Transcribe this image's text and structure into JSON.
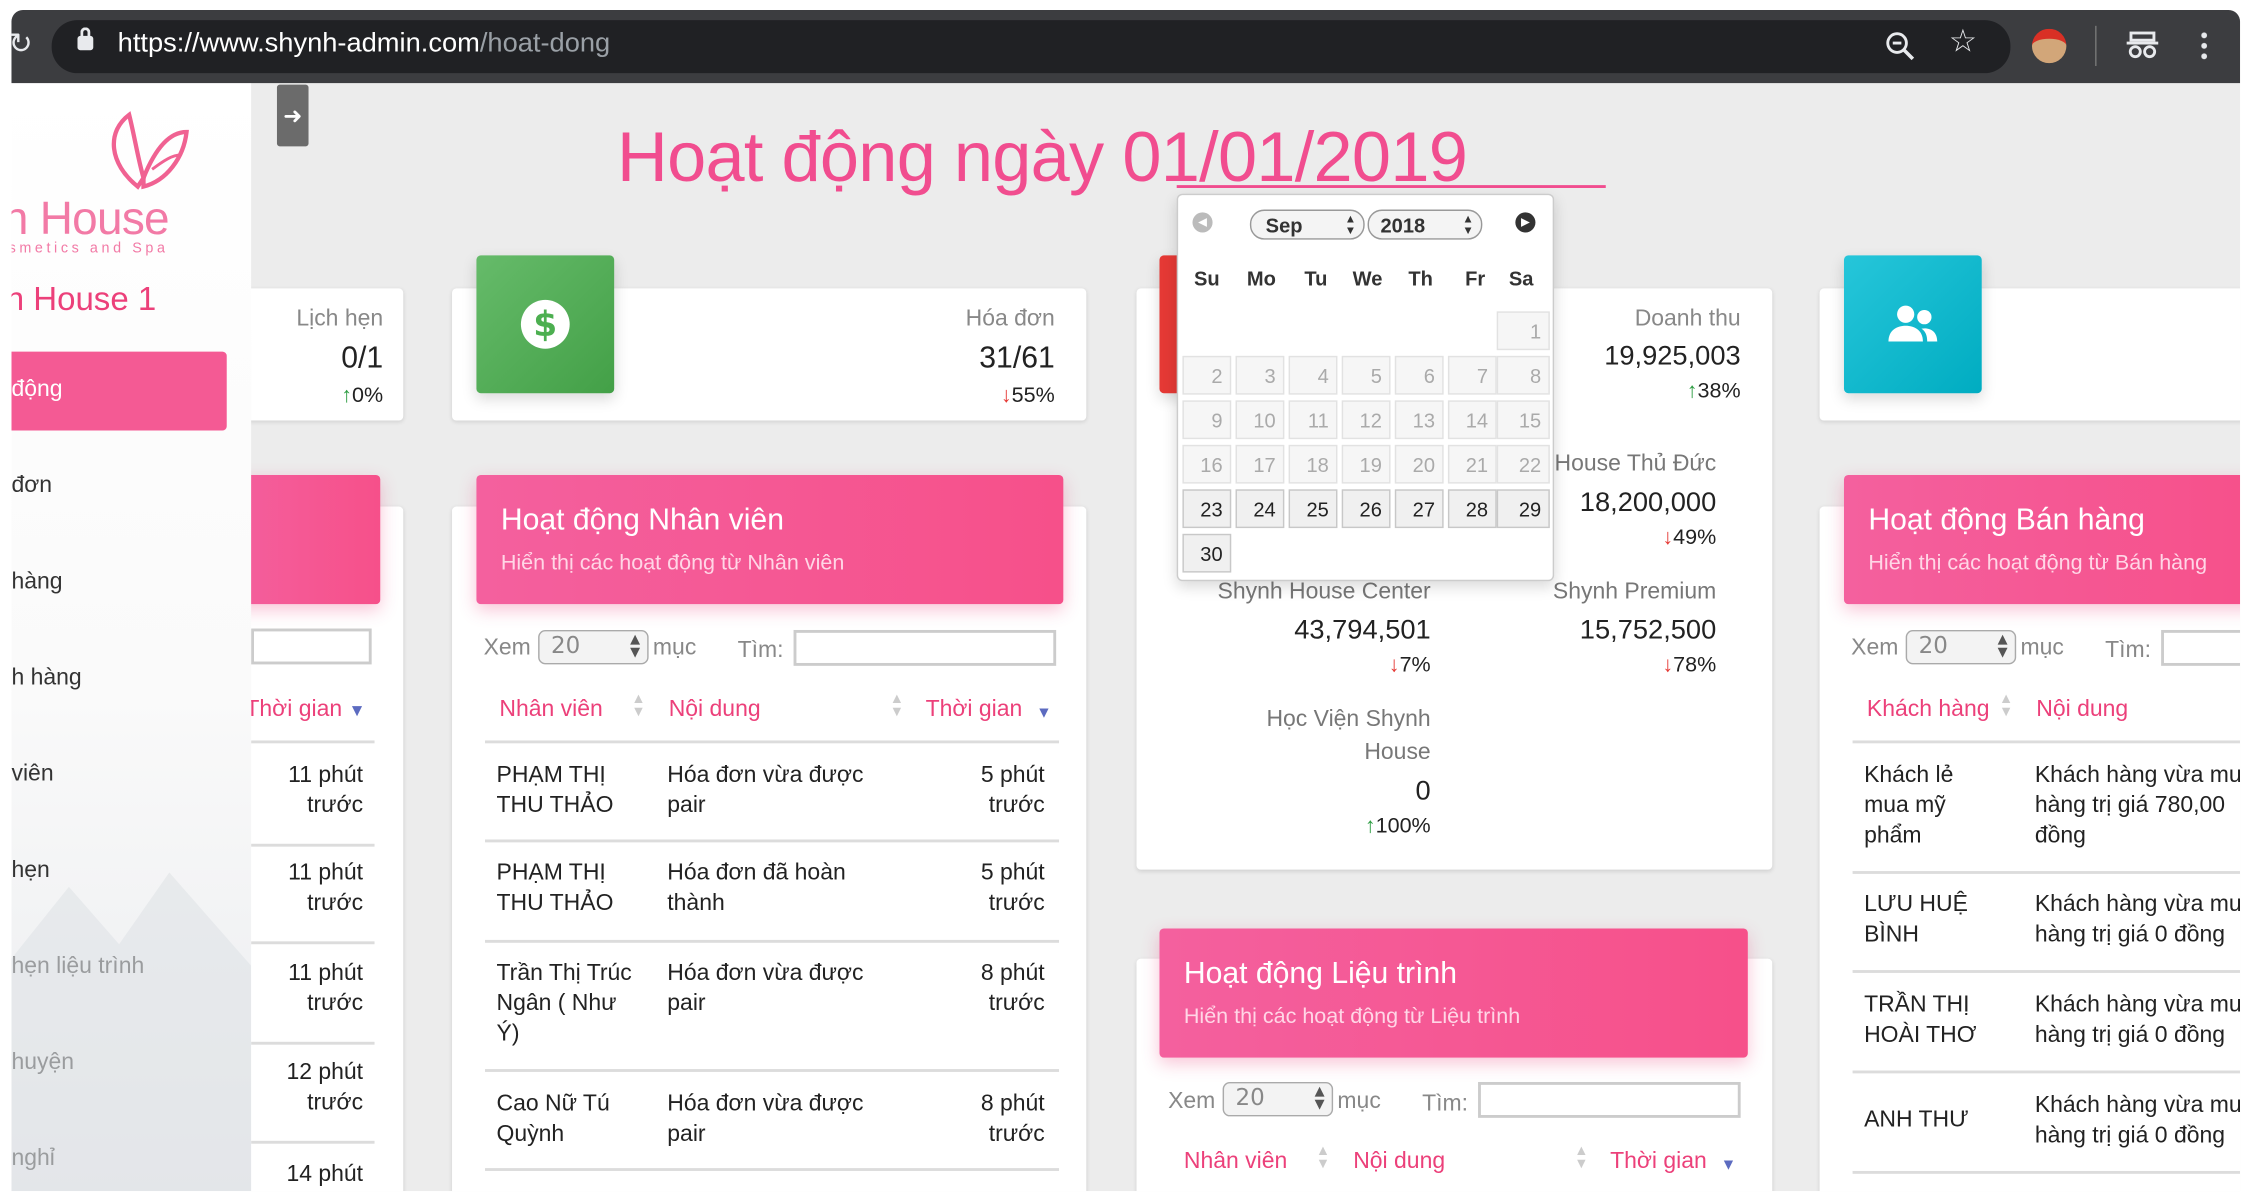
{
  "browser": {
    "url_main": "https://www.shynh-admin.com",
    "url_path": "/hoat-dong",
    "icons": [
      "reload-icon",
      "lock-icon",
      "zoom-icon",
      "star-icon",
      "extension-avatar-icon",
      "incognito-icon",
      "menu-kebab-icon"
    ]
  },
  "sidebar": {
    "logo_line1": "n House",
    "logo_line2": "smetics and Spa",
    "branch": "n House 1",
    "items": [
      {
        "label": "động",
        "active": true
      },
      {
        "label": "đơn"
      },
      {
        "label": "hàng"
      },
      {
        "label": "h hàng"
      },
      {
        "label": "viên"
      },
      {
        "label": "hẹn"
      },
      {
        "label": "hẹn liệu trình"
      },
      {
        "label": "huyện"
      },
      {
        "label": "nghỉ"
      }
    ]
  },
  "page": {
    "title": "Hoạt động ngày",
    "date": "01/01/2019",
    "back_icon": "arrow-left-icon"
  },
  "stats": {
    "appointments": {
      "label": "Lịch hẹn",
      "value": "0/1",
      "trend": "up",
      "percent": "0%"
    },
    "invoices": {
      "label": "Hóa đơn",
      "value": "31/61",
      "trend": "down",
      "percent": "55%",
      "icon": "dollar-icon"
    },
    "revenue": {
      "label": "Doanh thu",
      "value": "19,925,003",
      "trend": "up",
      "percent": "38%"
    },
    "users_icon": "users-icon"
  },
  "branches": [
    {
      "name": "House Thủ Đức",
      "value": "18,200,000",
      "trend": "down",
      "percent": "49%"
    },
    {
      "name": "Shynh House Center",
      "value": "43,794,501",
      "trend": "down",
      "percent": "7%"
    },
    {
      "name": "Shynh Premium",
      "value": "15,752,500",
      "trend": "down",
      "percent": "78%"
    },
    {
      "name_line1": "Học Viện Shynh",
      "name_line2": "House",
      "value": "0",
      "trend": "up",
      "percent": "100%"
    }
  ],
  "controls": {
    "show_label": "Xem",
    "show_value": "20",
    "entries_label": "mục",
    "search_label": "Tìm:"
  },
  "left_panel": {
    "col_time": "Thời gian",
    "times": [
      [
        "11 phút",
        "trước"
      ],
      [
        "11 phút",
        "trước"
      ],
      [
        "11 phút",
        "trước"
      ],
      [
        "12 phút",
        "trước"
      ],
      [
        "14 phút",
        ""
      ]
    ]
  },
  "staff_panel": {
    "title": "Hoạt động Nhân viên",
    "subtitle": "Hiển thị các hoạt động từ Nhân viên",
    "columns": [
      "Nhân viên",
      "Nội dung",
      "Thời gian"
    ],
    "rows": [
      {
        "name": [
          "PHẠM THỊ",
          "THU THẢO"
        ],
        "content": [
          "Hóa đơn vừa được",
          "pair"
        ],
        "time": [
          "5 phút",
          "trước"
        ]
      },
      {
        "name": [
          "PHẠM THỊ",
          "THU THẢO"
        ],
        "content": [
          "Hóa đơn đã hoàn",
          "thành"
        ],
        "time": [
          "5 phút",
          "trước"
        ]
      },
      {
        "name": [
          "Trần Thị Trúc",
          "Ngân ( Như",
          "Ý)"
        ],
        "content": [
          "Hóa đơn vừa được",
          "pair"
        ],
        "time": [
          "8 phút",
          "trước"
        ]
      },
      {
        "name": [
          "Cao Nữ Tú",
          "Quỳnh"
        ],
        "content": [
          "Hóa đơn vừa được",
          "pair"
        ],
        "time": [
          "8 phút",
          "trước"
        ]
      }
    ]
  },
  "treatment_panel": {
    "title": "Hoạt động Liệu trình",
    "subtitle": "Hiển thị các hoạt động từ Liệu trình",
    "columns": [
      "Nhân viên",
      "Nội dung",
      "Thời gian"
    ]
  },
  "sales_panel": {
    "title": "Hoạt động Bán hàng",
    "subtitle": "Hiển thị các hoạt động từ Bán hàng",
    "columns": [
      "Khách hàng",
      "Nội dung"
    ],
    "rows": [
      {
        "name": [
          "Khách lẻ",
          "mua mỹ",
          "phẩm"
        ],
        "content": [
          "Khách hàng vừa mu",
          "hàng trị giá 780,00",
          "đồng"
        ]
      },
      {
        "name": [
          "LƯU HUỆ",
          "BÌNH"
        ],
        "content": [
          "Khách hàng vừa mu",
          "hàng trị giá 0 đồng"
        ]
      },
      {
        "name": [
          "TRẦN THỊ",
          "HOÀI THƠ"
        ],
        "content": [
          "Khách hàng vừa mu",
          "hàng trị giá 0 đồng"
        ]
      },
      {
        "name": [
          "ANH THƯ"
        ],
        "content": [
          "Khách hàng vừa mu",
          "hàng trị giá 0 đồng"
        ]
      }
    ]
  },
  "calendar": {
    "month": "Sep",
    "year": "2018",
    "weekdays": [
      "Su",
      "Mo",
      "Tu",
      "We",
      "Th",
      "Fr",
      "Sa"
    ],
    "first_weekday": 6,
    "days_in_month": 30,
    "enabled_from": 23
  }
}
